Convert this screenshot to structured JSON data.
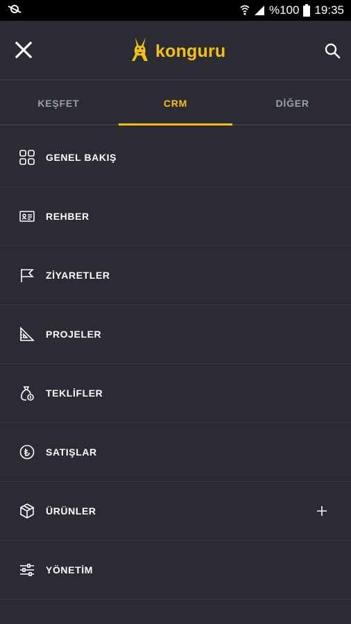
{
  "status_bar": {
    "battery_text": "%100",
    "time": "19:35"
  },
  "header": {
    "brand_name": "konguru",
    "brand_color": "#f4c20d"
  },
  "tabs": [
    {
      "label": "KEŞFET",
      "active": false
    },
    {
      "label": "CRM",
      "active": true
    },
    {
      "label": "DİĞER",
      "active": false
    }
  ],
  "menu": [
    {
      "label": "GENEL BAKIŞ",
      "icon": "grid-icon"
    },
    {
      "label": "REHBER",
      "icon": "contact-card-icon"
    },
    {
      "label": "ZİYARETLER",
      "icon": "flag-icon"
    },
    {
      "label": "PROJELER",
      "icon": "set-square-icon"
    },
    {
      "label": "TEKLİFLER",
      "icon": "offer-bag-icon"
    },
    {
      "label": "SATIŞLAR",
      "icon": "currency-coin-icon"
    },
    {
      "label": "ÜRÜNLER",
      "icon": "box-icon",
      "expandable": true
    },
    {
      "label": "YÖNETİM",
      "icon": "sliders-icon"
    }
  ]
}
